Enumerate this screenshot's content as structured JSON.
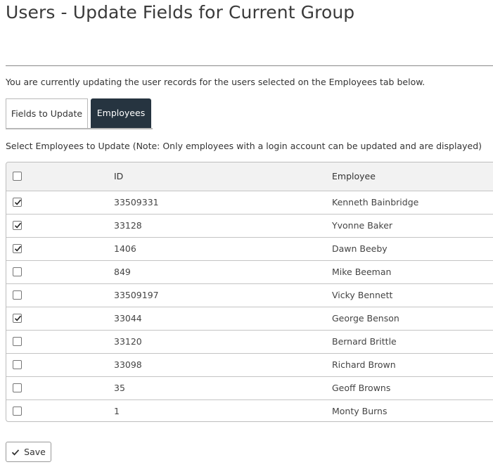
{
  "page": {
    "title": "Users - Update Fields for Current Group",
    "intro": "You are currently updating the user records for the users selected on the Employees tab below.",
    "select_note": "Select Employees to Update (Note: Only employees with a login account can be updated and are displayed)"
  },
  "tabs": [
    {
      "label": "Fields to Update",
      "active": false
    },
    {
      "label": "Employees",
      "active": true
    }
  ],
  "table": {
    "columns": [
      "ID",
      "Employee"
    ],
    "select_all_checked": false,
    "rows": [
      {
        "checked": true,
        "id": "33509331",
        "employee": "Kenneth Bainbridge"
      },
      {
        "checked": true,
        "id": "33128",
        "employee": "Yvonne Baker"
      },
      {
        "checked": true,
        "id": "1406",
        "employee": "Dawn Beeby"
      },
      {
        "checked": false,
        "id": "849",
        "employee": "Mike Beeman"
      },
      {
        "checked": false,
        "id": "33509197",
        "employee": "Vicky Bennett"
      },
      {
        "checked": true,
        "id": "33044",
        "employee": "George Benson"
      },
      {
        "checked": false,
        "id": "33120",
        "employee": "Bernard Brittle"
      },
      {
        "checked": false,
        "id": "33098",
        "employee": "Richard Brown"
      },
      {
        "checked": false,
        "id": "35",
        "employee": "Geoff Browns"
      },
      {
        "checked": false,
        "id": "1",
        "employee": "Monty Burns"
      }
    ]
  },
  "actions": {
    "save_label": "Save"
  },
  "colors": {
    "active_tab_bg": "#263440",
    "header_bg": "#f2f2f2",
    "border": "#bdbdbd"
  },
  "icons": {
    "row_check": "checkmark-icon",
    "save": "checkmark-icon"
  }
}
